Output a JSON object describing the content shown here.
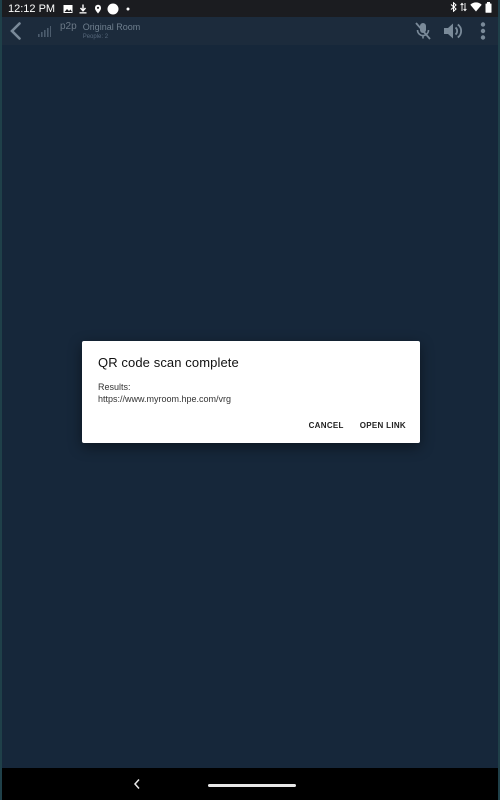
{
  "statusbar": {
    "time": "12:12 PM",
    "left_icons": [
      "image-icon",
      "download-icon",
      "maps-icon",
      "circle-icon",
      "dot-icon"
    ],
    "right_icons": [
      "bluetooth-icon",
      "data-arrows-icon",
      "wifi-icon",
      "battery-icon"
    ]
  },
  "appbar": {
    "mode": "p2p",
    "room_title": "Original Room",
    "people": "People: 2",
    "actions": [
      "mic-muted-icon",
      "volume-icon",
      "more-vert-icon"
    ]
  },
  "dialog": {
    "title": "QR code scan complete",
    "results_label": "Results:",
    "results_url": "https://www.myroom.hpe.com/vrg",
    "cancel_label": "CANCEL",
    "open_label": "OPEN LINK"
  },
  "navbar": {
    "back_icon": "nav-back-icon",
    "home_handle": "home-pill"
  },
  "colors": {
    "background": "#16273a",
    "appbar": "#1c2b3c",
    "statusbar": "#1b1c20",
    "dialog": "#ffffff"
  }
}
